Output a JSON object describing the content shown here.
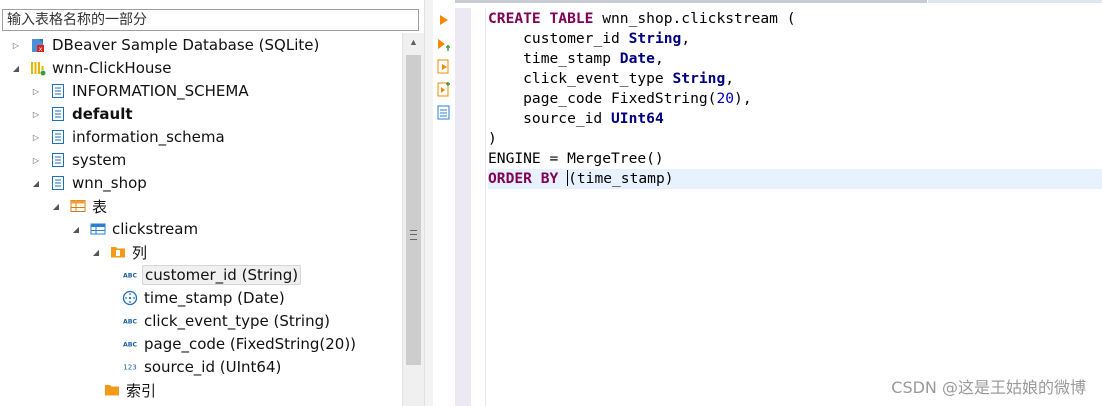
{
  "navigator": {
    "filter_placeholder": "输入表格名称的一部分",
    "tree": [
      {
        "label": "DBeaver Sample Database (SQLite)",
        "icon": "sqlite-database-icon",
        "expanded": false
      },
      {
        "label": "wnn-ClickHouse",
        "icon": "clickhouse-icon",
        "expanded": true
      },
      {
        "label": "INFORMATION_SCHEMA",
        "icon": "schema-icon",
        "expanded": false
      },
      {
        "label": "default",
        "icon": "schema-icon",
        "expanded": false,
        "bold": true
      },
      {
        "label": "information_schema",
        "icon": "schema-icon",
        "expanded": false
      },
      {
        "label": "system",
        "icon": "schema-icon",
        "expanded": false
      },
      {
        "label": "wnn_shop",
        "icon": "schema-icon",
        "expanded": true
      },
      {
        "label": "表",
        "icon": "tables-folder-icon",
        "expanded": true
      },
      {
        "label": "clickstream",
        "icon": "table-icon",
        "expanded": true
      },
      {
        "label": "列",
        "icon": "columns-folder-icon",
        "expanded": true
      },
      {
        "label": "customer_id (String)",
        "icon": "string-column-icon",
        "selected": true
      },
      {
        "label": "time_stamp (Date)",
        "icon": "date-column-icon"
      },
      {
        "label": "click_event_type (String)",
        "icon": "string-column-icon"
      },
      {
        "label": "page_code (FixedString(20))",
        "icon": "string-column-icon"
      },
      {
        "label": "source_id (UInt64)",
        "icon": "number-column-icon"
      },
      {
        "label": "索引",
        "icon": "folder-icon"
      }
    ],
    "icon_glyphs": {
      "abc": "ABC",
      "num": "123"
    }
  },
  "editor": {
    "lines": [
      [
        {
          "t": "CREATE TABLE",
          "c": "kw"
        },
        {
          "t": " wnn_shop.clickstream ("
        }
      ],
      [
        {
          "t": "    customer_id "
        },
        {
          "t": "String",
          "c": "ty"
        },
        {
          "t": ","
        }
      ],
      [
        {
          "t": "    time_stamp "
        },
        {
          "t": "Date",
          "c": "ty"
        },
        {
          "t": ","
        }
      ],
      [
        {
          "t": "    click_event_type "
        },
        {
          "t": "String",
          "c": "ty"
        },
        {
          "t": ","
        }
      ],
      [
        {
          "t": "    page_code FixedString("
        },
        {
          "t": "20",
          "c": "num"
        },
        {
          "t": "),"
        }
      ],
      [
        {
          "t": "    source_id "
        },
        {
          "t": "UInt64",
          "c": "ty"
        }
      ],
      [
        {
          "t": ")"
        }
      ],
      [
        {
          "t": "ENGINE = MergeTree()"
        }
      ],
      [
        {
          "t": "ORDER BY",
          "c": "kw"
        },
        {
          "t": " "
        },
        {
          "t": "|",
          "c": "caret"
        },
        {
          "t": "(time_stamp)"
        }
      ]
    ],
    "current_line": 8
  },
  "watermark": "CSDN @这是王姑娘的微博",
  "colors": {
    "keyword": "#7f0055",
    "type": "#000080",
    "number": "#0000c0",
    "current_line": "#e8f2fe"
  }
}
